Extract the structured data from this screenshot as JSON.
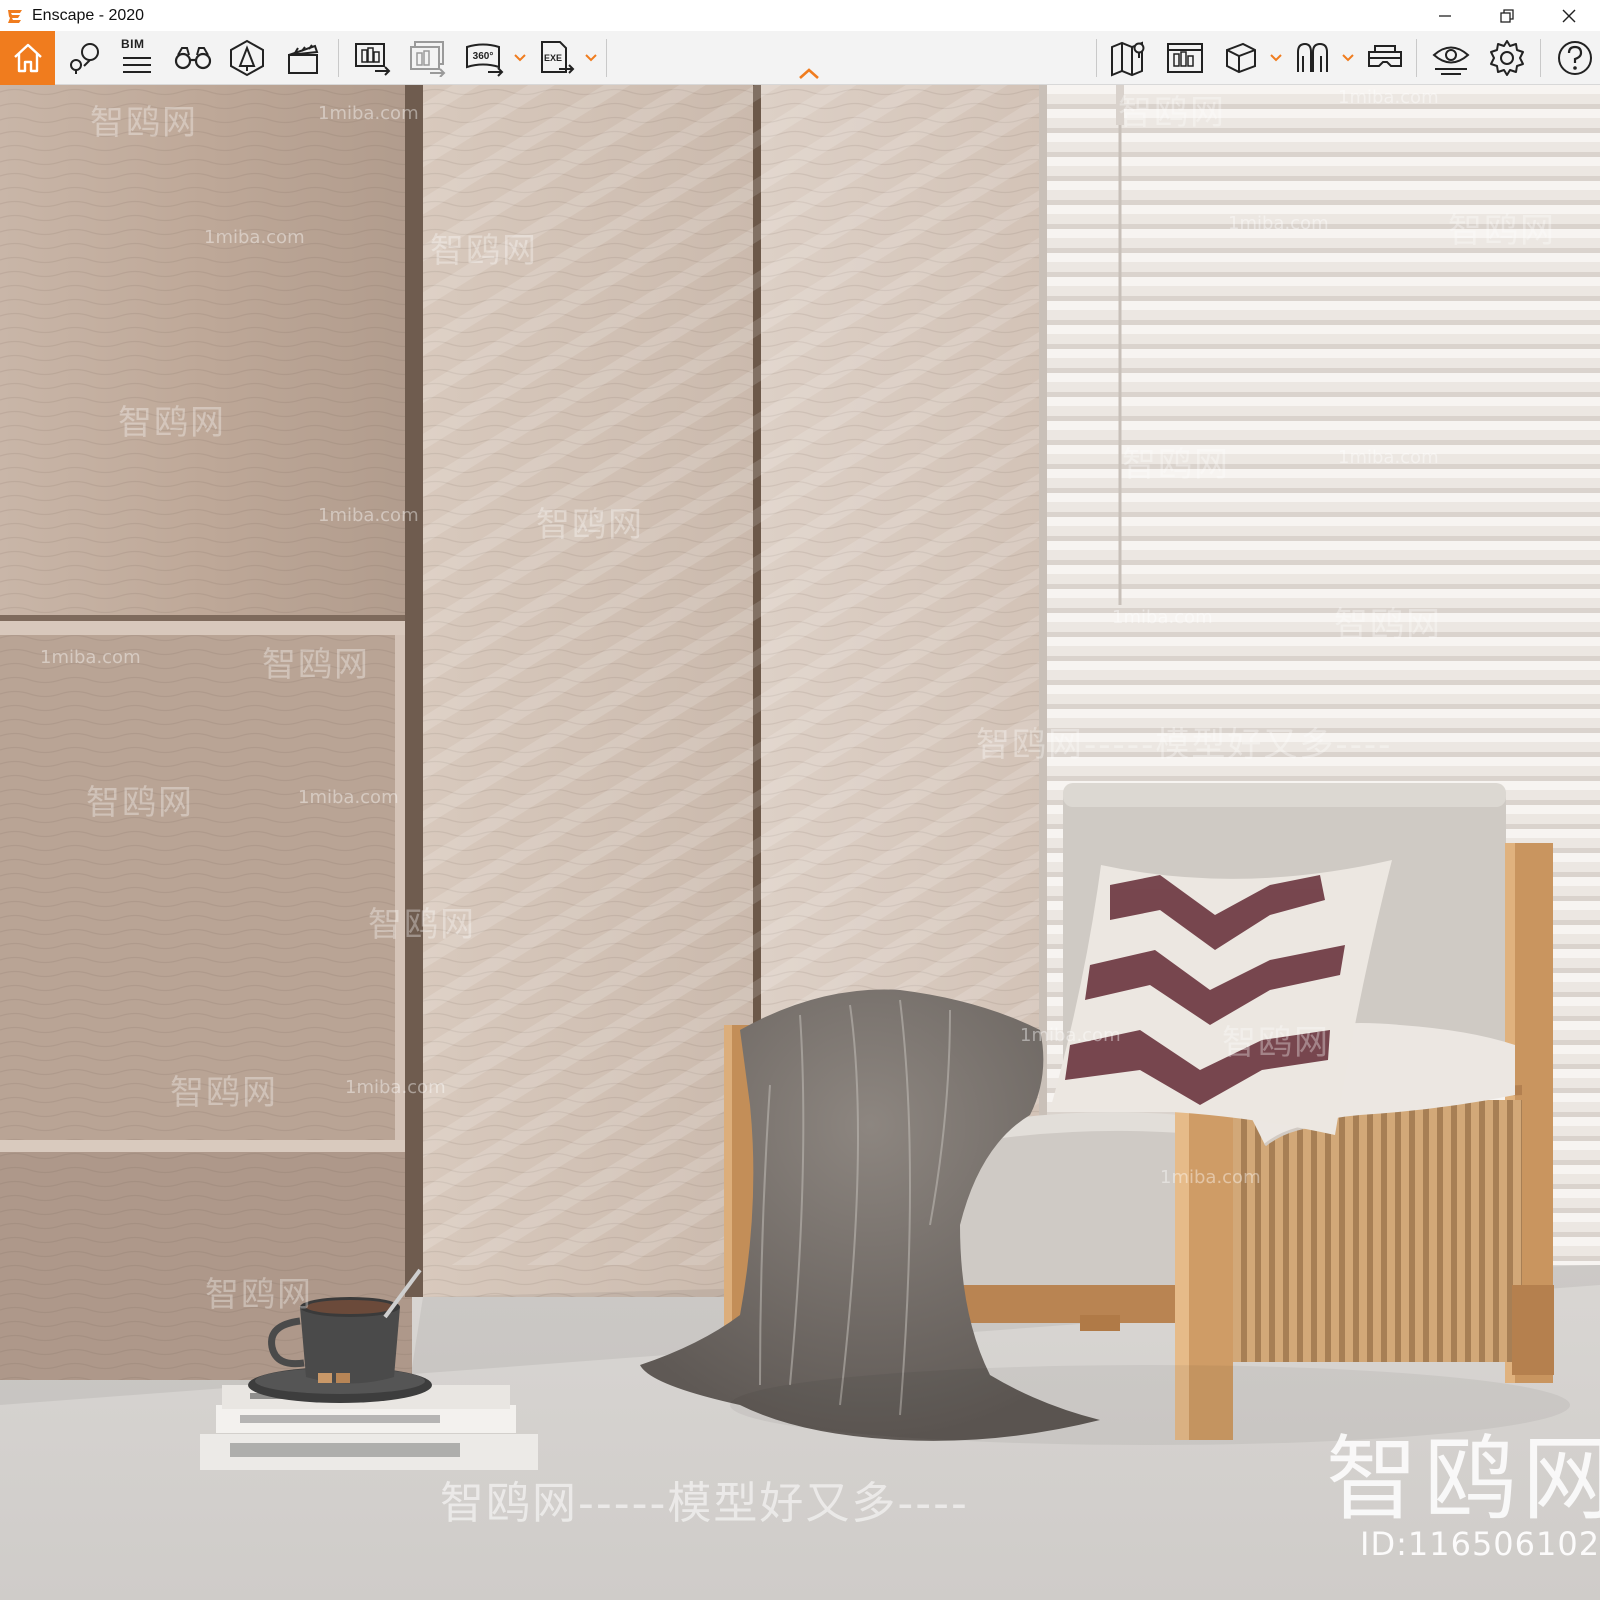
{
  "window": {
    "title": "Enscape - 2020",
    "accent_color": "#f07c1e"
  },
  "toolbar": {
    "home": {
      "icon": "home-icon"
    },
    "bim_label": "BIM",
    "left_tools": [
      {
        "name": "views-icon"
      },
      {
        "name": "bim-info-icon"
      },
      {
        "name": "binoculars-icon"
      },
      {
        "name": "asset-library-icon"
      },
      {
        "name": "video-editor-icon"
      },
      {
        "name": "batch-render-icon"
      },
      {
        "name": "upload-render-icon"
      },
      {
        "name": "panorama-360-icon"
      },
      {
        "name": "export-exe-icon"
      }
    ],
    "panorama_label": "360°",
    "exe_label": "EXE",
    "right_tools": [
      {
        "name": "map-icon"
      },
      {
        "name": "screenshot-gallery-icon"
      },
      {
        "name": "cube-view-icon"
      },
      {
        "name": "view-mode-icon"
      },
      {
        "name": "vr-headset-icon"
      },
      {
        "name": "visual-settings-icon"
      },
      {
        "name": "settings-gear-icon"
      },
      {
        "name": "help-icon"
      }
    ]
  },
  "watermarks": {
    "site": "1miba.com",
    "brand_cn": "智鸥网",
    "slogan_cn": "智鸥网-----模型好又多----",
    "slogan_mid": "智鸥网-----模型好又多----",
    "big_logo": "智鸥网",
    "id_text": "ID:116506102"
  }
}
